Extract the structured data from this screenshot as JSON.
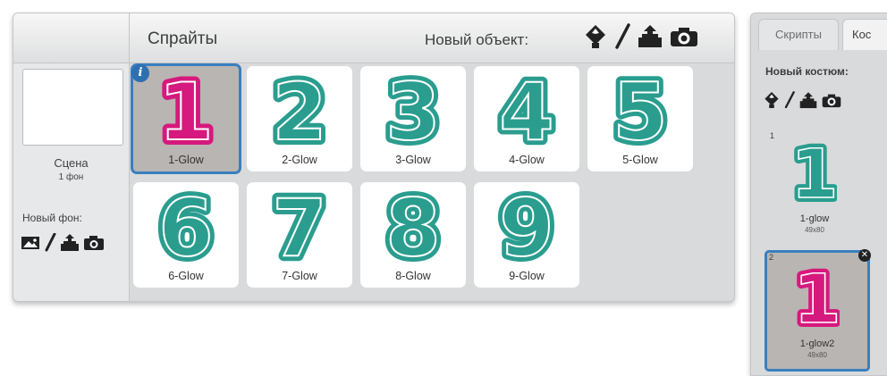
{
  "stage": {
    "name": "Сцена",
    "backdrop_count": "1 фон",
    "new_backdrop_label": "Новый фон:",
    "tools": [
      "picture-icon",
      "paintbrush-icon",
      "upload-icon",
      "camera-icon"
    ]
  },
  "sprites": {
    "title": "Спрайты",
    "new_object_label": "Новый объект:",
    "tools": [
      "sprite-library-icon",
      "paintbrush-icon",
      "upload-icon",
      "camera-icon"
    ],
    "items": [
      {
        "name": "1-Glow",
        "digit": "1",
        "color": "#d6197e",
        "selected": true
      },
      {
        "name": "2-Glow",
        "digit": "2",
        "color": "#2a9d8f",
        "selected": false
      },
      {
        "name": "3-Glow",
        "digit": "3",
        "color": "#2a9d8f",
        "selected": false
      },
      {
        "name": "4-Glow",
        "digit": "4",
        "color": "#2a9d8f",
        "selected": false
      },
      {
        "name": "5-Glow",
        "digit": "5",
        "color": "#2a9d8f",
        "selected": false
      },
      {
        "name": "6-Glow",
        "digit": "6",
        "color": "#2a9d8f",
        "selected": false
      },
      {
        "name": "7-Glow",
        "digit": "7",
        "color": "#2a9d8f",
        "selected": false
      },
      {
        "name": "8-Glow",
        "digit": "8",
        "color": "#2a9d8f",
        "selected": false
      },
      {
        "name": "9-Glow",
        "digit": "9",
        "color": "#2a9d8f",
        "selected": false
      }
    ]
  },
  "costumes_panel": {
    "tabs": [
      "Скрипты",
      "Кос"
    ],
    "new_costume_label": "Новый костюм:",
    "tools": [
      "sprite-library-icon",
      "paintbrush-icon",
      "upload-icon",
      "camera-icon"
    ],
    "items": [
      {
        "index": "1",
        "name": "1-glow",
        "size": "49x80",
        "digit": "1",
        "color": "#2a9d8f",
        "selected": false
      },
      {
        "index": "2",
        "name": "1-glow2",
        "size": "49x80",
        "digit": "1",
        "color": "#d6197e",
        "selected": true
      }
    ]
  },
  "colors": {
    "teal": "#2a9d8f",
    "magenta": "#d6197e",
    "selection_blue": "#3a7fc0"
  }
}
